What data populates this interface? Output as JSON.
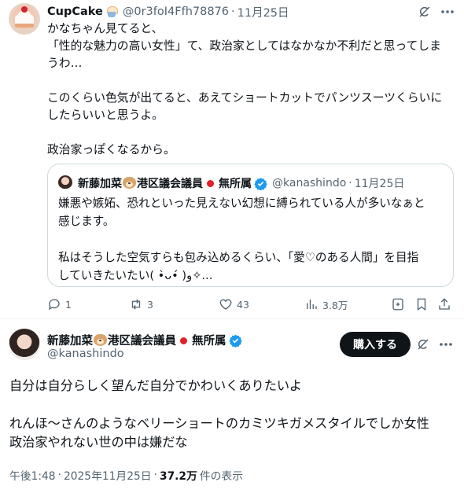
{
  "quoting_tweet": {
    "display_name": "CupCake",
    "handle": "@0r3foI4Ffh78876",
    "date": "11月25日",
    "text_lines": [
      "かなちゃん見てると、",
      "「性的な魅力の高い女性」て、政治家としてはなかなか不利だと思ってしま",
      "うわ…",
      "",
      "このくらい色気が出てると、あえてショートカットでパンツスーツくらいに",
      "したらいいと思うよ。",
      "",
      "政治家っぽくなるから。"
    ],
    "quoted": {
      "display_name_prefix": "新藤加菜",
      "display_name_suffix": "港区議会議員",
      "display_name_tail": "無所属",
      "handle": "@kanashindo",
      "date": "11月25日",
      "text_lines": [
        "嫌悪や嫉妬、恐れといった見えない幻想に縛られている人が多いなぁと",
        "感じます。",
        "",
        "私はそうした空気すらも包み込めるくらい、「愛♡のある人間」を目指",
        "していきたいたい( •̀ᴗ•́ )و✧..."
      ]
    },
    "actions": {
      "replies": "1",
      "reposts": "3",
      "likes": "43",
      "views": "3.8万"
    }
  },
  "main_tweet": {
    "display_name_prefix": "新藤加菜",
    "display_name_suffix": "港区議会議員",
    "display_name_tail": "無所属",
    "handle": "@kanashindo",
    "buy_label": "購入する",
    "text_lines": [
      "自分は自分らしく望んだ自分でかわいくありたいよ",
      "",
      "れんほ〜さんのようなベリーショートのカミツキガメスタイルでしか女性",
      "政治家やれない世の中は嫌だな"
    ],
    "time": "午後1:48",
    "date": "2025年11月25日",
    "views_count": "37.2万",
    "views_label": "件の表示"
  },
  "colors": {
    "text": "#0f1419",
    "secondary": "#536471",
    "verified": "#1d9bf0",
    "border": "#cfd9de",
    "flag": "#e0202a"
  }
}
